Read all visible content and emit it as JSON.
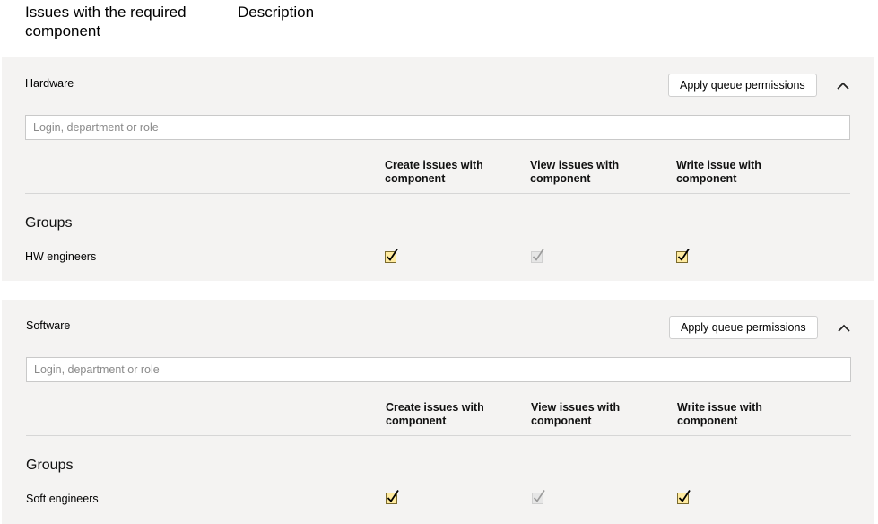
{
  "header": {
    "tab_issues": "Issues with the required component",
    "tab_description": "Description"
  },
  "icons": {
    "collapse": "chevron-up-icon",
    "checkbox": "check-icon"
  },
  "colors": {
    "panel_bg": "#f4f3f2",
    "checkbox_checked_fill": "#ffeba0",
    "checkbox_disabled_fill": "#e6e6e6"
  },
  "panels": [
    {
      "title": "Hardware",
      "apply_label": "Apply queue permissions",
      "search_placeholder": "Login, department or role",
      "columns": [
        "Create issues with component",
        "View issues with component",
        "Write issue with component"
      ],
      "groups_label": "Groups",
      "row": {
        "name": "HW engineers",
        "create": "checked",
        "view": "checked-disabled",
        "write": "checked"
      }
    },
    {
      "title": "Software",
      "apply_label": "Apply queue permissions",
      "search_placeholder": "Login, department or role",
      "columns": [
        "Create issues with component",
        "View issues with component",
        "Write issue with component"
      ],
      "groups_label": "Groups",
      "row": {
        "name": "Soft engineers",
        "create": "checked",
        "view": "checked-disabled",
        "write": "checked"
      }
    }
  ]
}
